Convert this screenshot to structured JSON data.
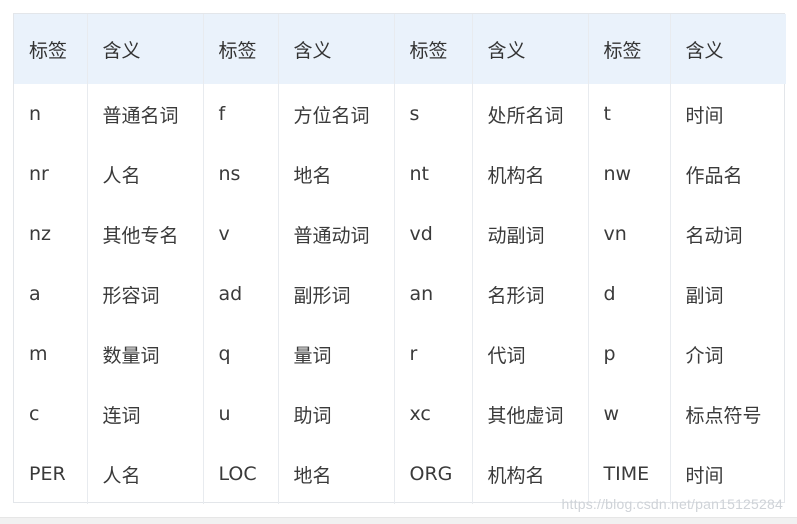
{
  "table": {
    "headers": [
      "标签",
      "含义",
      "标签",
      "含义",
      "标签",
      "含义",
      "标签",
      "含义"
    ],
    "rows": [
      [
        "n",
        "普通名词",
        "f",
        "方位名词",
        "s",
        "处所名词",
        "t",
        "时间"
      ],
      [
        "nr",
        "人名",
        "ns",
        "地名",
        "nt",
        "机构名",
        "nw",
        "作品名"
      ],
      [
        "nz",
        "其他专名",
        "v",
        "普通动词",
        "vd",
        "动副词",
        "vn",
        "名动词"
      ],
      [
        "a",
        "形容词",
        "ad",
        "副形词",
        "an",
        "名形词",
        "d",
        "副词"
      ],
      [
        "m",
        "数量词",
        "q",
        "量词",
        "r",
        "代词",
        "p",
        "介词"
      ],
      [
        "c",
        "连词",
        "u",
        "助词",
        "xc",
        "其他虚词",
        "w",
        "标点符号"
      ],
      [
        "PER",
        "人名",
        "LOC",
        "地名",
        "ORG",
        "机构名",
        "TIME",
        "时间"
      ]
    ]
  },
  "watermark": "https://blog.csdn.net/pan15125284",
  "colors": {
    "header_bg": "#eaf2fb",
    "border": "#e8ebef",
    "text": "#3a3a3a"
  }
}
